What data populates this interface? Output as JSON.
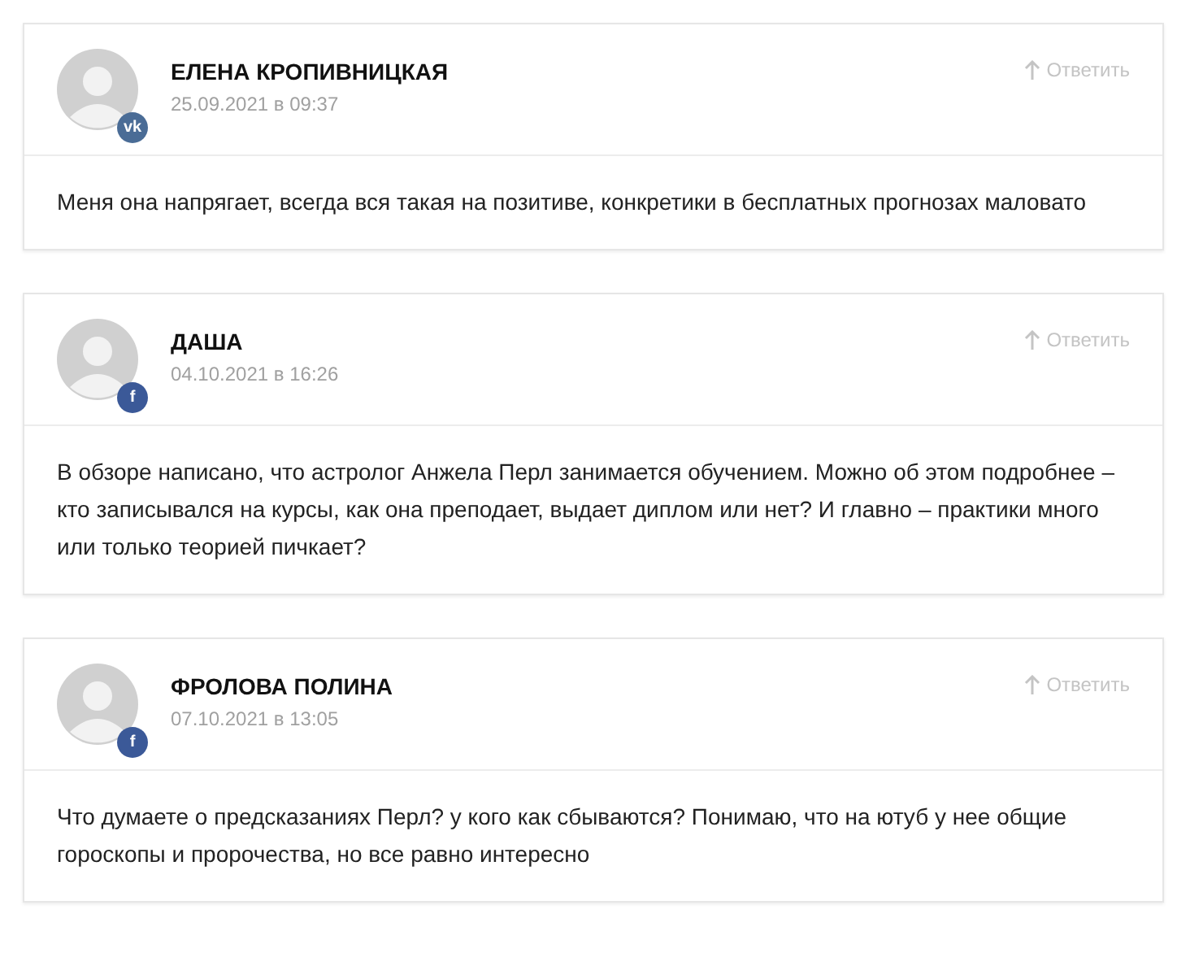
{
  "comments": [
    {
      "author": "ЕЛЕНА КРОПИВНИЦКАЯ",
      "date": "25.09.2021 в 09:37",
      "badge": {
        "kind": "vk",
        "text": "vk"
      },
      "reply": "Ответить",
      "text": "Меня она напрягает, всегда вся такая на позитиве, конкретики в бесплатных прогнозах маловато"
    },
    {
      "author": "ДАША",
      "date": "04.10.2021 в 16:26",
      "badge": {
        "kind": "facebook",
        "text": "f"
      },
      "reply": "Ответить",
      "text": "В обзоре написано, что астролог Анжела Перл занимается обучением. Можно об этом подробнее – кто записывался на курсы, как она преподает, выдает диплом или нет? И главно – практики много или только теорией пичкает?"
    },
    {
      "author": "ФРОЛОВА ПОЛИНА",
      "date": "07.10.2021 в 13:05",
      "badge": {
        "kind": "facebook",
        "text": "f"
      },
      "reply": "Ответить",
      "text": "Что думаете о предсказаниях Перл? у кого как сбываются? Понимаю, что на ютуб у нее общие гороскопы и пророчества, но все равно интересно"
    }
  ]
}
